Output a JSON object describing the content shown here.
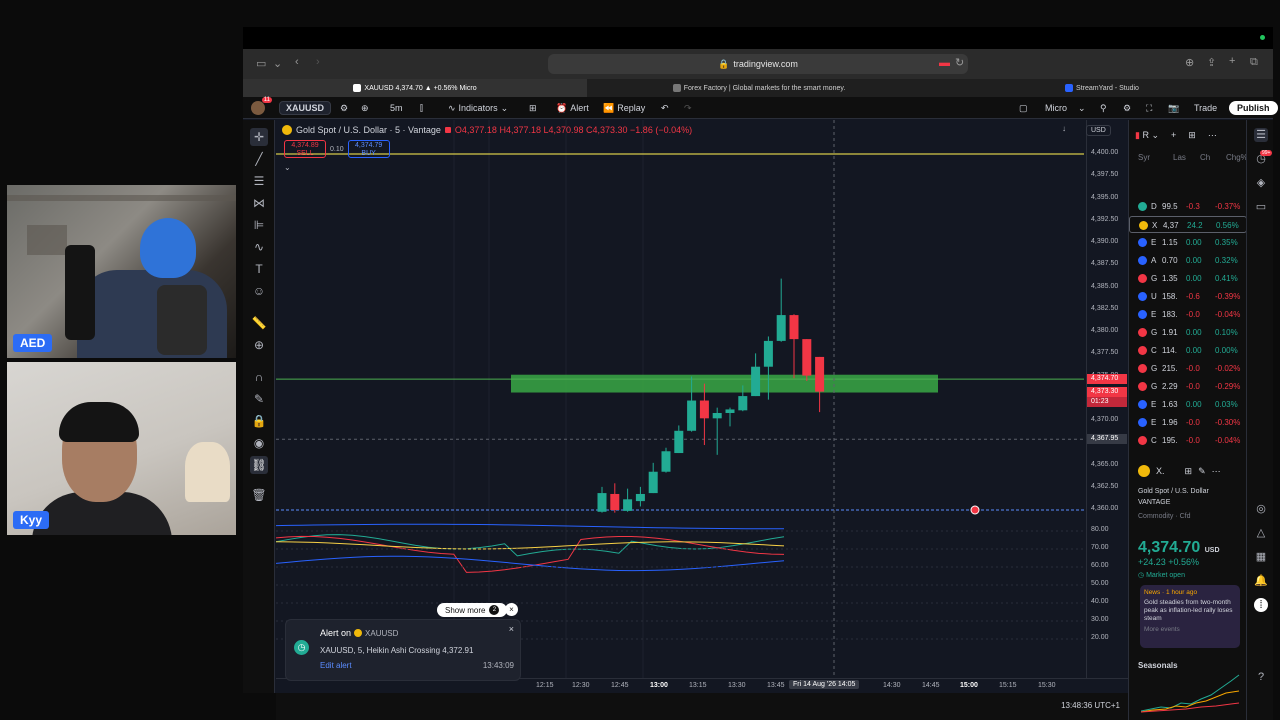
{
  "participants": [
    {
      "label": "AED"
    },
    {
      "label": "Kyy"
    }
  ],
  "browser": {
    "url": "tradingview.com",
    "tabs": [
      {
        "label": "XAUUSD 4,374.70 ▲ +0.56% Micro",
        "active": true
      },
      {
        "label": "Forex Factory | Global markets for the smart money.",
        "active": false
      },
      {
        "label": "StreamYard - Studio",
        "active": false
      }
    ]
  },
  "toolbar": {
    "avatar_badge": "11",
    "symbol": "XAUUSD",
    "interval": "5m",
    "indicators": "Indicators",
    "alert": "Alert",
    "replay": "Replay",
    "account": "Micro",
    "trade": "Trade",
    "publish": "Publish"
  },
  "chart": {
    "legend_title": "Gold Spot / U.S. Dollar · 5 · Vantage",
    "ohlc": "O4,377.18 H4,377.18 L4,370.98 C4,373.30 −1.86 (−0.04%)",
    "sell_price": "4,374.89",
    "sell_label": "SELL",
    "spread": "0.10",
    "buy_price": "4,374.79",
    "buy_label": "BUY",
    "currency": "USD",
    "price_ticks": [
      "4,400.00",
      "4,397.50",
      "4,395.00",
      "4,392.50",
      "4,390.00",
      "4,387.50",
      "4,385.00",
      "4,382.50",
      "4,380.00",
      "4,377.50",
      "4,375.00",
      "4,372.50",
      "4,370.00",
      "4,367.50",
      "4,365.00",
      "4,362.50",
      "4,360.00"
    ],
    "osc_ticks": [
      "80.00",
      "70.00",
      "60.00",
      "50.00",
      "40.00",
      "30.00",
      "20.00"
    ],
    "tags": {
      "last": "4,374.70",
      "close": "4,373.30",
      "countdown": "01:23",
      "cursor": "4,367.95"
    },
    "time_ticks": [
      {
        "t": "12:15",
        "bold": false
      },
      {
        "t": "12:30",
        "bold": false
      },
      {
        "t": "12:45",
        "bold": false
      },
      {
        "t": "13:00",
        "bold": true
      },
      {
        "t": "13:15",
        "bold": false
      },
      {
        "t": "13:30",
        "bold": false
      },
      {
        "t": "13:45",
        "bold": false
      },
      {
        "t": "14:30",
        "bold": false
      },
      {
        "t": "14:45",
        "bold": false
      },
      {
        "t": "15:00",
        "bold": true
      },
      {
        "t": "15:15",
        "bold": false
      },
      {
        "t": "15:30",
        "bold": false
      }
    ],
    "time_cursor": "Fri 14 Aug '26",
    "time_cursor2": "14:05",
    "clock": "13:48:36 UTC+1",
    "candles": [
      {
        "o": 4359.8,
        "h": 4362.6,
        "l": 4359.7,
        "c": 4361.9
      },
      {
        "o": 4361.8,
        "h": 4363.0,
        "l": 4359.7,
        "c": 4360.0
      },
      {
        "o": 4359.9,
        "h": 4362.4,
        "l": 4359.8,
        "c": 4361.2
      },
      {
        "o": 4361.0,
        "h": 4362.6,
        "l": 4360.4,
        "c": 4361.8
      },
      {
        "o": 4361.9,
        "h": 4365.3,
        "l": 4361.9,
        "c": 4364.3
      },
      {
        "o": 4364.3,
        "h": 4367.0,
        "l": 4364.2,
        "c": 4366.6
      },
      {
        "o": 4366.4,
        "h": 4369.5,
        "l": 4366.4,
        "c": 4368.9
      },
      {
        "o": 4368.9,
        "h": 4375.0,
        "l": 4368.8,
        "c": 4372.3
      },
      {
        "o": 4372.3,
        "h": 4374.2,
        "l": 4367.3,
        "c": 4370.3
      },
      {
        "o": 4370.3,
        "h": 4371.5,
        "l": 4366.2,
        "c": 4370.9
      },
      {
        "o": 4370.9,
        "h": 4371.5,
        "l": 4369.4,
        "c": 4371.3
      },
      {
        "o": 4371.2,
        "h": 4374.0,
        "l": 4371.1,
        "c": 4372.8
      },
      {
        "o": 4372.8,
        "h": 4377.6,
        "l": 4372.8,
        "c": 4376.1
      },
      {
        "o": 4376.1,
        "h": 4379.5,
        "l": 4372.4,
        "c": 4379.0
      },
      {
        "o": 4379.0,
        "h": 4386.0,
        "l": 4378.9,
        "c": 4381.9
      },
      {
        "o": 4381.9,
        "h": 4382.0,
        "l": 4374.8,
        "c": 4379.2
      },
      {
        "o": 4379.2,
        "h": 4379.2,
        "l": 4374.5,
        "c": 4375.1
      },
      {
        "o": 4377.2,
        "h": 4377.2,
        "l": 4371.0,
        "c": 4373.3
      }
    ]
  },
  "alert": {
    "show_more": "Show more",
    "show_more_count": "2",
    "title": "Alert on",
    "symbol": "XAUUSD",
    "description": "XAUUSD, 5, Heikin Ashi Crossing 4,372.91",
    "edit": "Edit alert",
    "time": "13:43:09"
  },
  "watchlist": {
    "header": "R",
    "columns": [
      "Syr",
      "Las",
      "Ch",
      "Chg%"
    ],
    "rows": [
      {
        "s": "D",
        "l": "99.5",
        "c": "-0.3",
        "p": "-0.37%",
        "dir": "neg",
        "color": "#22ab94"
      },
      {
        "s": "X",
        "l": "4,37",
        "c": "24.2",
        "p": "0.56%",
        "dir": "pos",
        "color": "#f0b90b"
      },
      {
        "s": "E",
        "l": "1.15",
        "c": "0.00",
        "p": "0.35%",
        "dir": "pos",
        "color": "#2962ff"
      },
      {
        "s": "A",
        "l": "0.70",
        "c": "0.00",
        "p": "0.32%",
        "dir": "pos",
        "color": "#2962ff"
      },
      {
        "s": "G",
        "l": "1.35",
        "c": "0.00",
        "p": "0.41%",
        "dir": "pos",
        "color": "#f23645"
      },
      {
        "s": "U",
        "l": "158.",
        "c": "-0.6",
        "p": "-0.39%",
        "dir": "neg",
        "color": "#2962ff"
      },
      {
        "s": "E",
        "l": "183.",
        "c": "-0.0",
        "p": "-0.04%",
        "dir": "neg",
        "color": "#2962ff"
      },
      {
        "s": "G",
        "l": "1.91",
        "c": "0.00",
        "p": "0.10%",
        "dir": "pos",
        "color": "#f23645"
      },
      {
        "s": "C",
        "l": "114.",
        "c": "0.00",
        "p": "0.00%",
        "dir": "pos",
        "color": "#f23645"
      },
      {
        "s": "G",
        "l": "215.",
        "c": "-0.0",
        "p": "-0.02%",
        "dir": "neg",
        "color": "#f23645"
      },
      {
        "s": "G",
        "l": "2.29",
        "c": "-0.0",
        "p": "-0.29%",
        "dir": "neg",
        "color": "#f23645"
      },
      {
        "s": "E",
        "l": "1.63",
        "c": "0.00",
        "p": "0.03%",
        "dir": "pos",
        "color": "#2962ff"
      },
      {
        "s": "E",
        "l": "1.96",
        "c": "-0.0",
        "p": "-0.30%",
        "dir": "neg",
        "color": "#2962ff"
      },
      {
        "s": "C",
        "l": "195.",
        "c": "-0.0",
        "p": "-0.04%",
        "dir": "neg",
        "color": "#f23645"
      }
    ],
    "detail": {
      "short": "X.",
      "name": "Gold Spot / U.S. Dollar",
      "exchange": "VANTAGE",
      "category": "Commodity · Cfd",
      "price": "4,374.70",
      "currency": "USD",
      "change": "+24.23 +0.56%",
      "status": "Market open",
      "news_head": "News · 1 hour ago",
      "news_body": "Gold steadies from two-month peak as inflation-led rally loses steam",
      "news_more": "More events",
      "seasonals": "Seasonals"
    }
  },
  "rail_badge": "99+"
}
